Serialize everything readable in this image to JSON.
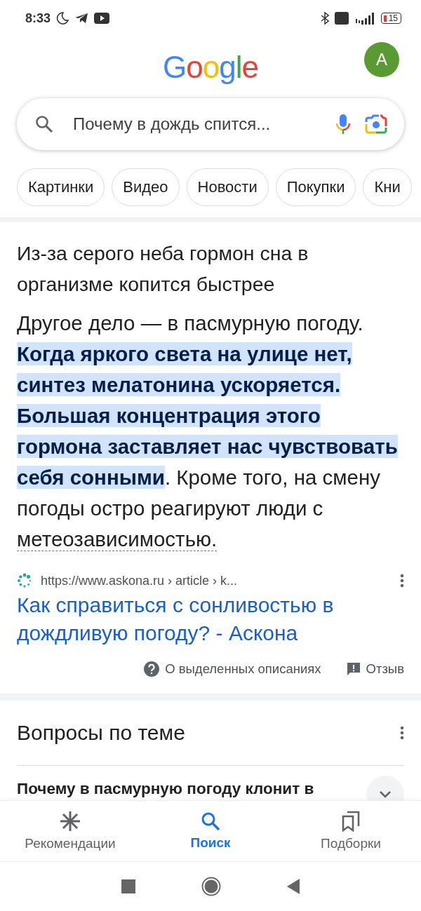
{
  "status_bar": {
    "time": "8:33",
    "battery": "15"
  },
  "header": {
    "logo": "Google",
    "avatar": "A"
  },
  "search": {
    "value": "Почему в дождь спится..."
  },
  "chips": [
    {
      "label": "Картинки"
    },
    {
      "label": "Видео"
    },
    {
      "label": "Новости"
    },
    {
      "label": "Покупки"
    },
    {
      "label": "Кни"
    }
  ],
  "answer": {
    "heading": "Из-за серого неба гормон сна в организме копится быстрее",
    "segments": [
      {
        "kind": "plain",
        "text": "Другое дело — в пасмурную погоду. "
      },
      {
        "kind": "highlight",
        "text": "Когда яркого света на улице нет, синтез мелатонина ускоряется. Большая концентрация этого гормона заставляет нас чувствовать себя сонными"
      },
      {
        "kind": "plain",
        "text": ". Кроме того, на смену погоды остро реагируют люди с "
      },
      {
        "kind": "term",
        "text": "метеозависимостью."
      }
    ],
    "source_url": "https://www.askona.ru › article › k...",
    "title": "Как справиться с сонливостью в дождливую погоду? - Аскона",
    "about": "О выделенных описаниях",
    "feedback": "Отзыв"
  },
  "related": {
    "heading": "Вопросы по теме",
    "questions": [
      "Почему в пасмурную погоду клонит в"
    ]
  },
  "bottom_nav": [
    {
      "label": "Рекомендации",
      "kind": "discover",
      "selected": false
    },
    {
      "label": "Поиск",
      "kind": "search",
      "selected": true
    },
    {
      "label": "Подборки",
      "kind": "collections",
      "selected": false
    }
  ]
}
